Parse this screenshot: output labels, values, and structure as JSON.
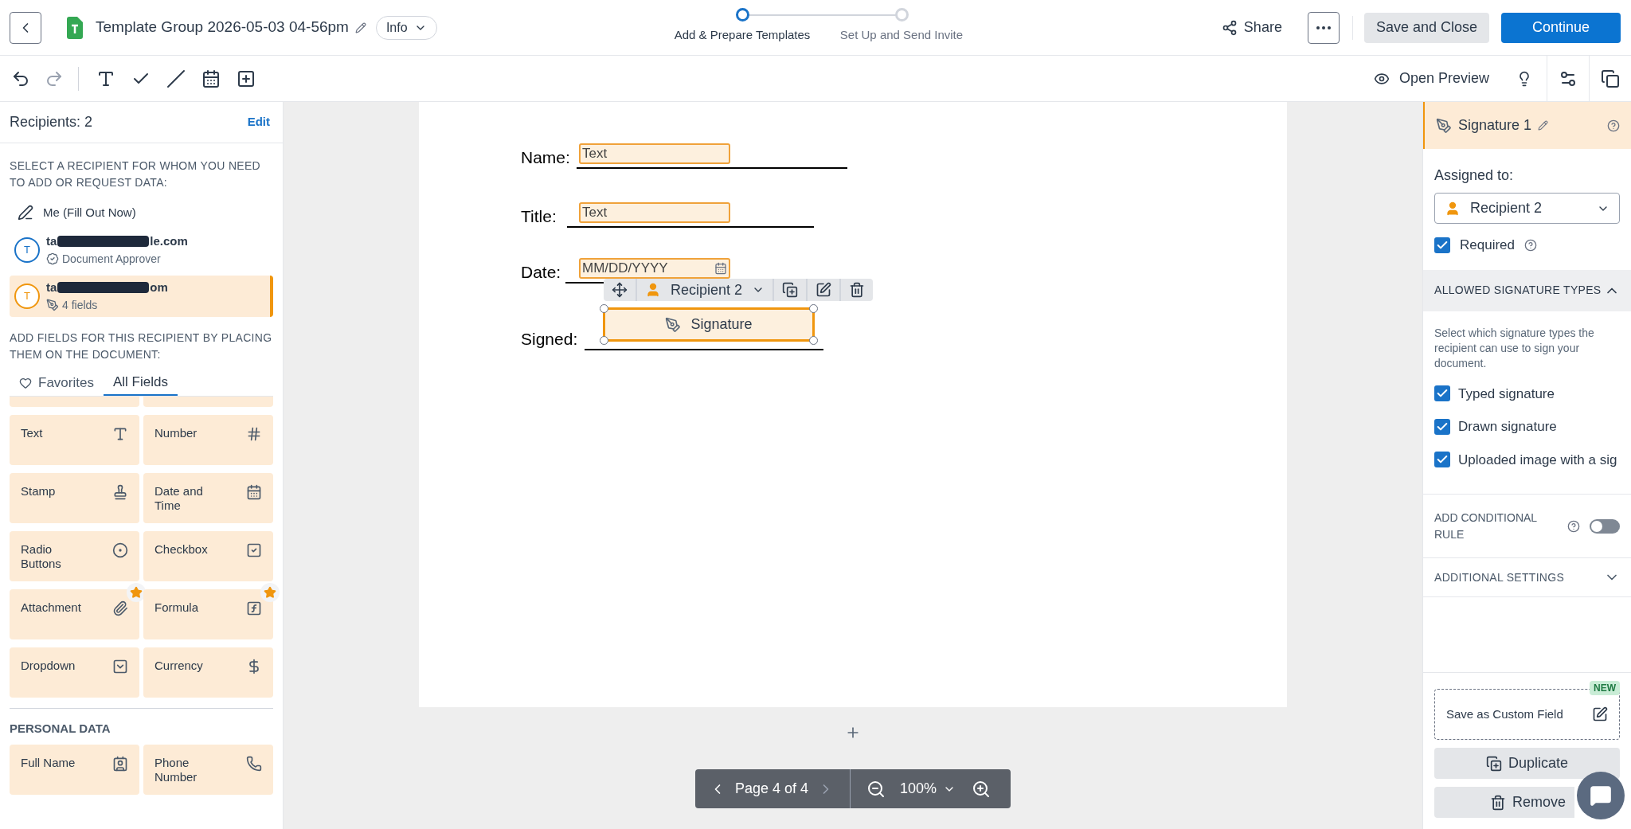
{
  "header": {
    "title": "Template Group 2026-05-03 04-56pm",
    "info_label": "Info",
    "steps": [
      {
        "label": "Add & Prepare Templates",
        "selected": true
      },
      {
        "label": "Set Up and Send Invite",
        "selected": false
      }
    ],
    "share": "Share",
    "save_close": "Save and Close",
    "continue": "Continue"
  },
  "toolbar": {
    "preview": "Open Preview"
  },
  "left": {
    "recipients_title": "Recipients: 2",
    "edit": "Edit",
    "select_heading": "SELECT A RECIPIENT FOR WHOM YOU NEED TO ADD OR REQUEST DATA:",
    "me": "Me (Fill Out Now)",
    "recipients": [
      {
        "email_start": "ta",
        "email_end": "le.com",
        "detail": "Document Approver",
        "kind": "approver",
        "color": "#1a73c8",
        "selected": false,
        "initial": "T"
      },
      {
        "email_start": "ta",
        "email_end": "om",
        "detail": "4 fields",
        "kind": "signer",
        "color": "#f0960e",
        "selected": true,
        "initial": "T"
      }
    ],
    "add_heading": "ADD FIELDS FOR THIS RECIPIENT BY PLACING THEM ON THE DOCUMENT:",
    "tabs": [
      {
        "label": "Favorites",
        "selected": false
      },
      {
        "label": "All Fields",
        "selected": true
      }
    ],
    "fields": [
      {
        "label": "Text",
        "kind": "text",
        "starred": false
      },
      {
        "label": "Number",
        "kind": "number",
        "starred": false
      },
      {
        "label": "Stamp",
        "kind": "stamp",
        "starred": false
      },
      {
        "label": "Date and Time",
        "kind": "date",
        "starred": false
      },
      {
        "label": "Radio Buttons",
        "kind": "radio",
        "starred": false
      },
      {
        "label": "Checkbox",
        "kind": "checkbox",
        "starred": false
      },
      {
        "label": "Attachment",
        "kind": "attachment",
        "starred": true
      },
      {
        "label": "Formula",
        "kind": "formula",
        "starred": true
      },
      {
        "label": "Dropdown",
        "kind": "dropdown",
        "starred": false
      },
      {
        "label": "Currency",
        "kind": "currency",
        "starred": false
      }
    ],
    "personal_heading": "PERSONAL DATA",
    "personal_fields": [
      {
        "label": "Full Name",
        "kind": "name",
        "starred": false
      },
      {
        "label": "Phone Number",
        "kind": "phone",
        "starred": false
      }
    ]
  },
  "document": {
    "lines": [
      {
        "label": "Name:",
        "kind": "text",
        "field": "Text"
      },
      {
        "label": "Title:",
        "kind": "text",
        "field": "Text"
      },
      {
        "label": "Date:",
        "kind": "date",
        "field": "MM/DD/YYYY"
      },
      {
        "label": "Signed:",
        "kind": "signature",
        "field": "Signature"
      }
    ],
    "popup_recipient": "Recipient 2"
  },
  "pager": {
    "page": "Page 4 of 4",
    "zoom": "100%"
  },
  "right": {
    "field_name": "Signature 1",
    "assigned_label": "Assigned to:",
    "assigned": "Recipient 2",
    "required": {
      "label": "Required",
      "checked": true
    },
    "allowed": {
      "title": "ALLOWED SIGNATURE TYPES",
      "expanded": true,
      "description": "Select which signature types the recipient can use to sign your document.",
      "options": [
        {
          "label": "Typed signature",
          "checked": true
        },
        {
          "label": "Drawn signature",
          "checked": true
        },
        {
          "label": "Uploaded image with a sig",
          "checked": true
        }
      ]
    },
    "conditional": {
      "label": "ADD CONDITIONAL RULE",
      "on": false
    },
    "additional": {
      "title": "ADDITIONAL SETTINGS",
      "expanded": false
    },
    "custom_field": "Save as Custom Field",
    "new_badge": "NEW",
    "duplicate": "Duplicate",
    "remove": "Remove"
  }
}
